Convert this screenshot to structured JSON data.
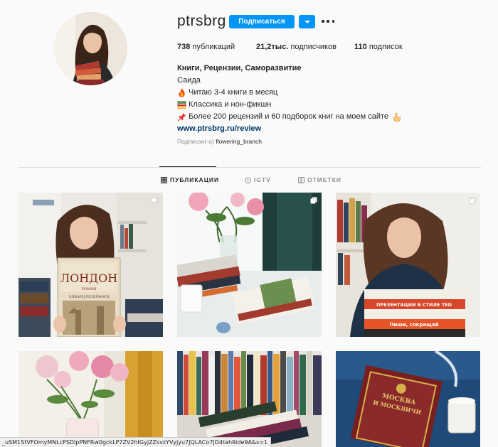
{
  "profile": {
    "username": "ptrsbrg",
    "follow_label": "Подписаться",
    "stats": [
      {
        "count": "738",
        "label": "публикаций"
      },
      {
        "count": "21,2тыс.",
        "label": "подписчиков"
      },
      {
        "count": "110",
        "label": "подписок"
      }
    ],
    "bio": {
      "name": "Книги, Рецензии, Саморазвитие",
      "real_name": "Саида",
      "lines": [
        {
          "emoji": "fire-emoji",
          "text": "Читаю 3-4 книги в месяц"
        },
        {
          "emoji": "books-emoji",
          "text": "Классика и нон-фикшн"
        },
        {
          "emoji": "pushpin-emoji",
          "text": "Более 200 рецензий и 60 подборок книг на моем сайте"
        }
      ],
      "link": "www.ptrsbrg.ru/review"
    },
    "followed_by_prefix": "Подписан(-а)",
    "followed_by_user": "flowering_branch"
  },
  "tabs": [
    {
      "label": "ПУБЛИКАЦИИ",
      "icon": "grid-icon",
      "active": true
    },
    {
      "label": "IGTV",
      "icon": "igtv-icon",
      "active": false
    },
    {
      "label": "ОТМЕТКИ",
      "icon": "tagged-icon",
      "active": false
    }
  ],
  "posts": [
    {
      "type": "video",
      "book_title": "ЛОНДОН",
      "book_sub": "РОМАН",
      "book_author": "ЭДВАРД РЕЗЕРФОРД"
    },
    {
      "type": "carousel"
    },
    {
      "type": "carousel",
      "book_lines": [
        "ПРЕЗЕНТАЦИИ В СТИЛЕ TED",
        "Пиши, сокращай"
      ]
    },
    {
      "type": "image"
    },
    {
      "type": "image"
    },
    {
      "type": "image",
      "book_lines": [
        "МОСКВА",
        "И МОСКВИЧИ"
      ]
    }
  ],
  "status_url": "_uSM1StVFOmyMNLcPSDlpPNFRw0gckLP7ZV2hIGyjZZsvzYVyjyu7JQLACo7JD4tah9ide9A&s=1",
  "colors": {
    "accent": "#0095f6",
    "link": "#00376b"
  }
}
